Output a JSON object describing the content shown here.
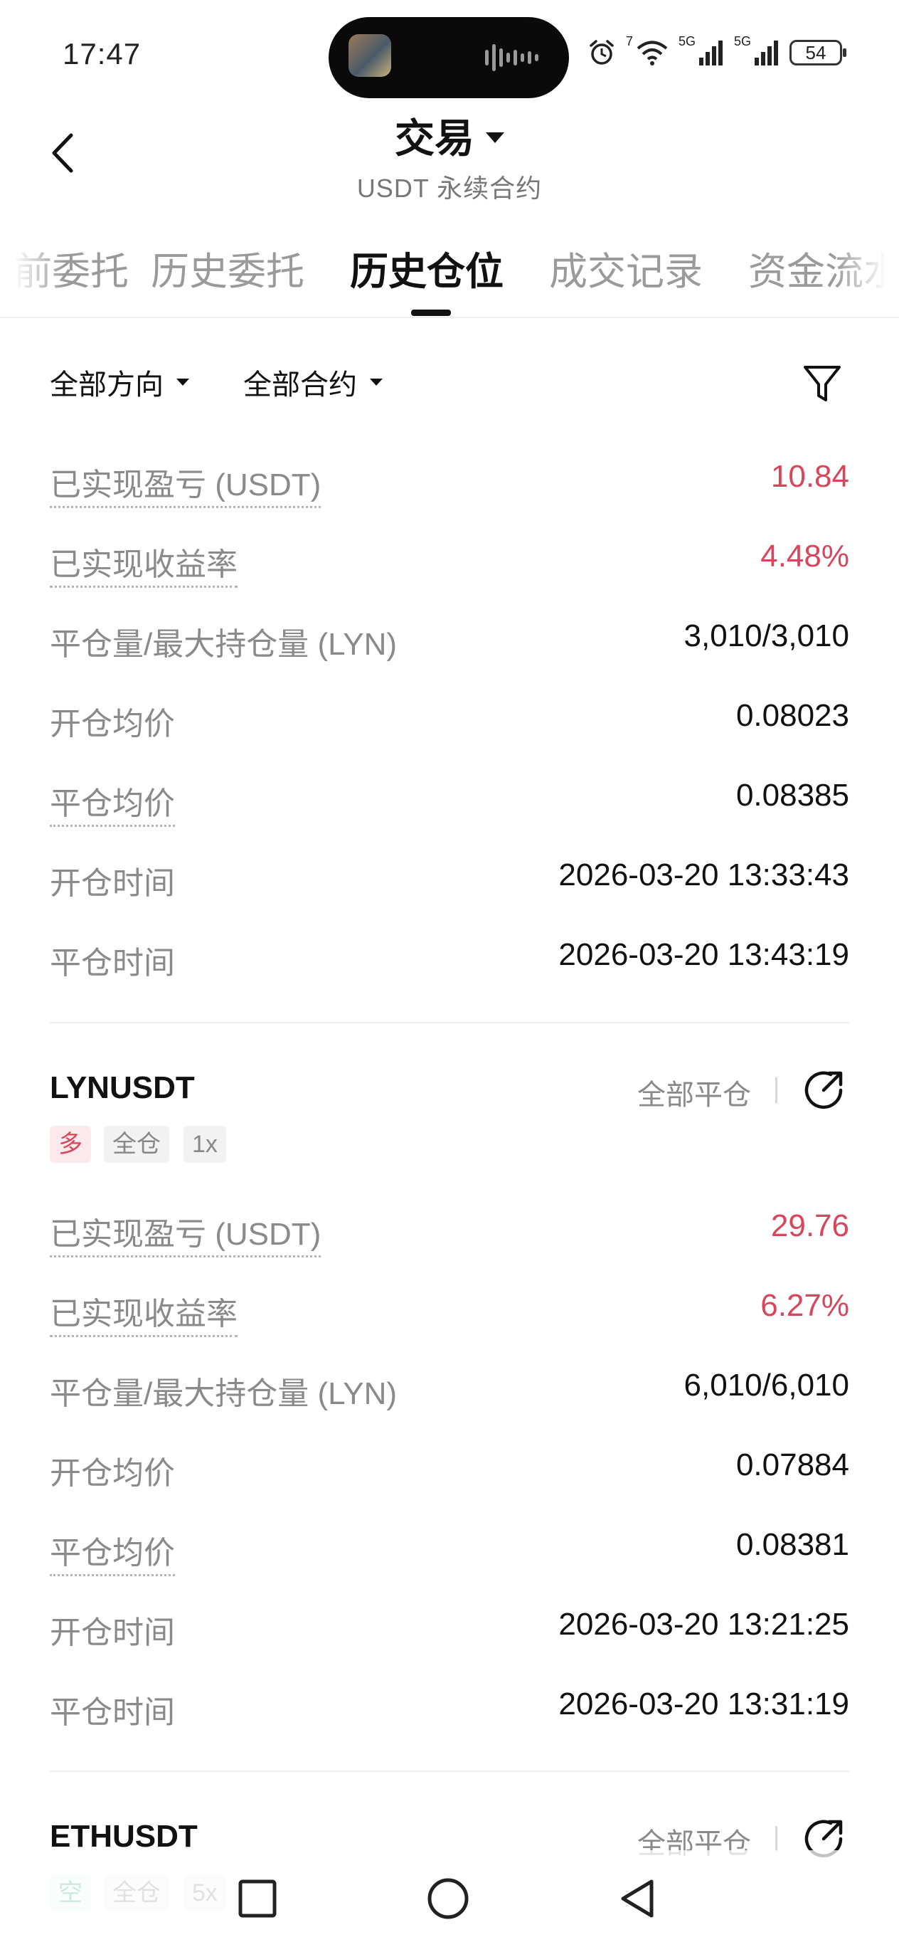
{
  "status_bar": {
    "time": "17:47",
    "network_1": "5G",
    "network_2": "5G",
    "wifi_badge": "7",
    "battery": "54",
    "icons": [
      "alarm-icon",
      "wifi-icon",
      "signal-icon",
      "signal-icon",
      "battery-icon"
    ]
  },
  "header": {
    "title": "交易",
    "subtitle": "USDT 永续合约",
    "back_icon": "chevron-left-icon"
  },
  "tabs": [
    {
      "label": "当前委托",
      "active": false
    },
    {
      "label": "历史委托",
      "active": false
    },
    {
      "label": "历史仓位",
      "active": true
    },
    {
      "label": "成交记录",
      "active": false
    },
    {
      "label": "资金流水",
      "active": false
    }
  ],
  "filters": {
    "direction": "全部方向",
    "contract": "全部合约",
    "filter_icon": "funnel-icon"
  },
  "card0": {
    "rows": [
      {
        "label": "已实现盈亏 (USDT)",
        "value": "10.84"
      },
      {
        "label": "已实现收益率",
        "value": "4.48%"
      },
      {
        "label": "平仓量/最大持仓量 (LYN)",
        "value": "3,010/3,010"
      },
      {
        "label": "开仓均价",
        "value": "0.08023"
      },
      {
        "label": "平仓均价",
        "value": "0.08385"
      },
      {
        "label": "开仓时间",
        "value": "2026-03-20 13:33:43"
      },
      {
        "label": "平仓时间",
        "value": "2026-03-20 13:43:19"
      }
    ]
  },
  "card1": {
    "symbol": "LYNUSDT",
    "action": "全部平仓",
    "badges": {
      "side": "多",
      "margin": "全仓",
      "leverage": "1x"
    },
    "rows": [
      {
        "label": "已实现盈亏 (USDT)",
        "value": "29.76"
      },
      {
        "label": "已实现收益率",
        "value": "6.27%"
      },
      {
        "label": "平仓量/最大持仓量 (LYN)",
        "value": "6,010/6,010"
      },
      {
        "label": "开仓均价",
        "value": "0.07884"
      },
      {
        "label": "平仓均价",
        "value": "0.08381"
      },
      {
        "label": "开仓时间",
        "value": "2026-03-20 13:21:25"
      },
      {
        "label": "平仓时间",
        "value": "2026-03-20 13:31:19"
      }
    ]
  },
  "card2": {
    "symbol": "ETHUSDT",
    "action": "全部平仓",
    "badges": {
      "side": "空",
      "margin": "全仓",
      "leverage": "5x"
    }
  },
  "colors": {
    "profit_red": "#d9455b",
    "label_gray": "#8a8a8a",
    "text_black": "#111111"
  }
}
